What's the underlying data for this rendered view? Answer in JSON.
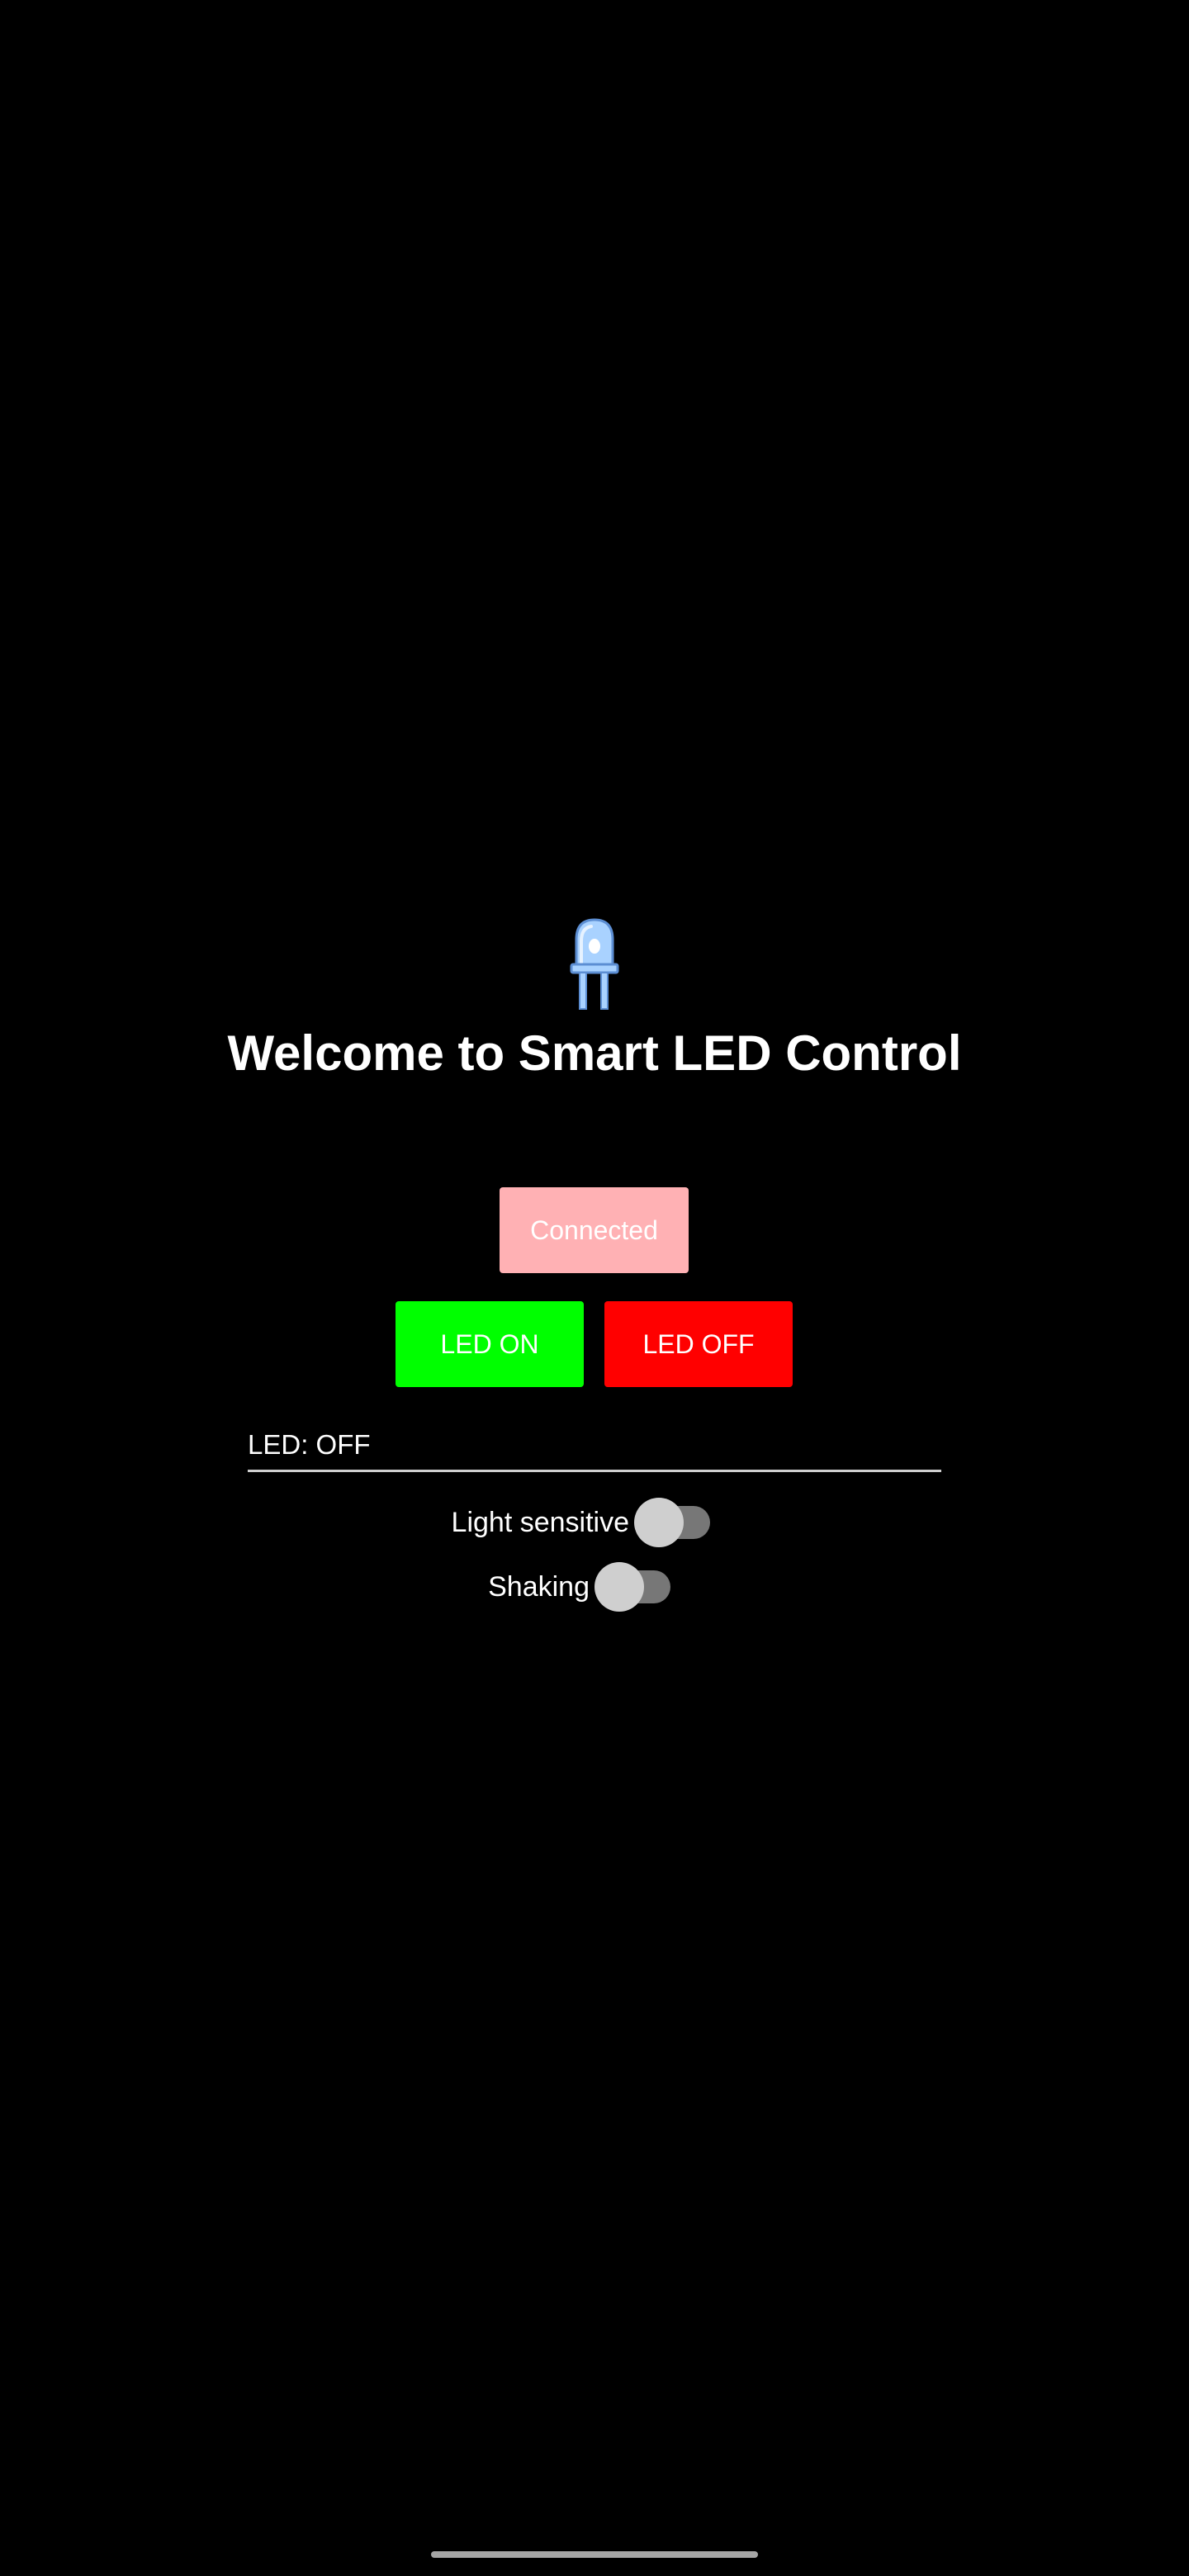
{
  "header": {
    "icon": "led-bulb-icon",
    "title": "Welcome to Smart LED Control"
  },
  "connection": {
    "label": "Connected",
    "color": "#ffb1b4"
  },
  "controls": {
    "on_label": "LED ON",
    "on_color": "#00ff00",
    "off_label": "LED OFF",
    "off_color": "#ff0000"
  },
  "status": {
    "text": "LED: OFF"
  },
  "toggles": [
    {
      "label": "Light sensitive",
      "checked": false
    },
    {
      "label": "Shaking",
      "checked": false
    }
  ],
  "colors": {
    "background": "#000000",
    "text": "#ffffff",
    "icon_accent": "#a9d2ff"
  }
}
